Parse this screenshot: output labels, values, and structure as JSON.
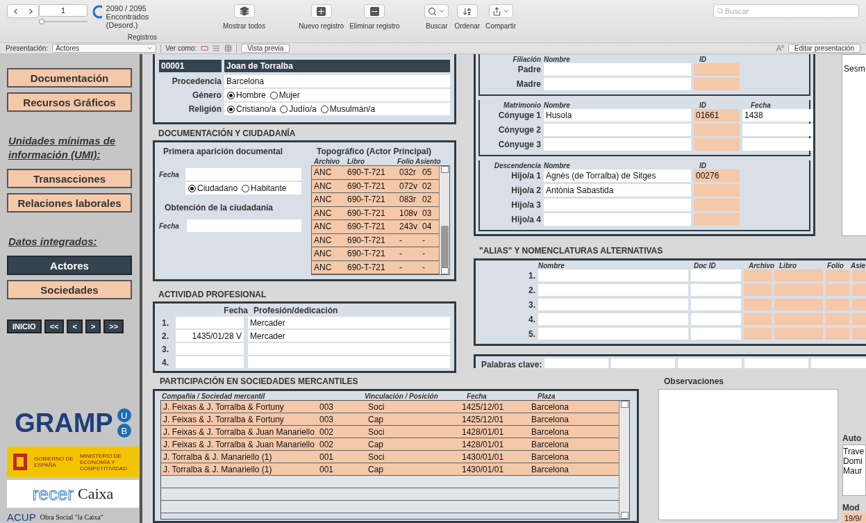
{
  "toolbar": {
    "record_field": {
      "value": "1"
    },
    "record_slider": {
      "level": 0.0
    },
    "found_count": "2090 / 2095",
    "found_status": "Encontrados (Desord.)",
    "records_label": "Registros",
    "actions": [
      {
        "kind": "show_all",
        "label": "Mostrar todos"
      },
      {
        "kind": "new",
        "label": "Nuevo registro"
      },
      {
        "kind": "delete",
        "label": "Eliminar registro"
      },
      {
        "kind": "search",
        "label": "Buscar"
      },
      {
        "kind": "sort",
        "label": "Ordenar"
      },
      {
        "kind": "share",
        "label": "Compartir"
      }
    ],
    "search": {
      "placeholder": "Buscar"
    }
  },
  "layout_bar": {
    "presentation_label": "Presentación:",
    "presentation_value": "Actores",
    "view_label": "Ver como:",
    "view_modes": [
      {
        "kind": "form",
        "selected": true
      },
      {
        "kind": "list",
        "selected": false
      },
      {
        "kind": "table",
        "selected": false
      }
    ],
    "preview_button": "Vista previa",
    "edit_button": "Editar presentación"
  },
  "sidebar": {
    "items": [
      {
        "kind": "button",
        "label": "Documentación",
        "selected": false
      },
      {
        "kind": "button",
        "label": "Recursos Gráficos",
        "selected": false
      },
      {
        "kind": "heading",
        "label": "Unidades mínimas de información (UMI):"
      },
      {
        "kind": "button",
        "label": "Transacciones",
        "selected": false
      },
      {
        "kind": "button",
        "label": "Relaciones laborales",
        "selected": false
      },
      {
        "kind": "heading",
        "label": "Datos integrados:"
      },
      {
        "kind": "button",
        "label": "Actores",
        "selected": true
      },
      {
        "kind": "button",
        "label": "Sociedades",
        "selected": false
      }
    ],
    "nav": [
      "INICIO",
      "<<",
      "<",
      ">",
      ">>"
    ],
    "logos": [
      {
        "kind": "gramp",
        "texts": [
          "GRAMP",
          "U",
          "B"
        ]
      },
      {
        "kind": "gobierno",
        "texts": [
          "GOBIERNO DE ESPAÑA",
          "MINISTERIO DE ECONOMÍA Y COMPETITIVIDAD"
        ]
      },
      {
        "kind": "recercaixa",
        "texts": [
          "recer",
          "Caixa"
        ]
      },
      {
        "kind": "acup",
        "texts": [
          "ACUP",
          "Obra Social \"la Caixa\""
        ]
      }
    ]
  },
  "actor": {
    "id": "00001",
    "name": "Joan de Torralba",
    "procedencia_label": "Procedencia",
    "procedencia": "Barcelona",
    "genero_label": "Género",
    "genero_options": [
      {
        "label": "Hombre",
        "selected": true
      },
      {
        "label": "Mujer",
        "selected": false
      }
    ],
    "religion_label": "Religión",
    "religion_options": [
      {
        "label": "Cristiano/a",
        "selected": true
      },
      {
        "label": "Judío/a",
        "selected": false
      },
      {
        "label": "Musulmán/a",
        "selected": false
      }
    ]
  },
  "documentacion": {
    "title": "DOCUMENTACIÓN Y CIUDADANÍA",
    "primera": {
      "title": "Primera aparición documental",
      "date_label": "Fecha"
    },
    "status_options": [
      {
        "label": "Ciudadano",
        "selected": true
      },
      {
        "label": "Habitante",
        "selected": false
      }
    ],
    "obtencion": {
      "title": "Obtención de la ciudadanía",
      "date_label": "Fecha"
    },
    "topografico": {
      "title": "Topográfico (Actor Principal)",
      "columns": [
        "Archivo",
        "Libro",
        "Folio",
        "Asiento"
      ],
      "rows": [
        [
          "ANC",
          "690-T-721",
          "032r",
          "05"
        ],
        [
          "ANC",
          "690-T-721",
          "072v",
          "02"
        ],
        [
          "ANC",
          "690-T-721",
          "083r",
          "02"
        ],
        [
          "ANC",
          "690-T-721",
          "108v",
          "03"
        ],
        [
          "ANC",
          "690-T-721",
          "243v",
          "04"
        ],
        [
          "ANC",
          "690-T-721",
          "-",
          "-"
        ],
        [
          "ANC",
          "690-T-721",
          "-",
          "-"
        ],
        [
          "ANC",
          "690-T-721",
          "-",
          "-"
        ]
      ]
    }
  },
  "actividad": {
    "title": "ACTIVIDAD PROFESIONAL",
    "columns": [
      "Fecha",
      "Profesión/dedicación"
    ],
    "rows": [
      {
        "number": "1.",
        "profession": "Mercader"
      },
      {
        "number": "2.",
        "date": "1435/01/28 V",
        "profession": "Mercader"
      },
      {
        "number": "3."
      },
      {
        "number": "4."
      }
    ]
  },
  "family": [
    {
      "label": "Filiación",
      "columns": [
        "Nombre",
        "ID"
      ],
      "rows": [
        {
          "label": "Padre"
        },
        {
          "label": "Madre"
        }
      ]
    },
    {
      "label": "Matrimonio",
      "columns": [
        "Nombre",
        "ID",
        "Fecha"
      ],
      "rows": [
        {
          "label": "Cónyuge 1",
          "name": "Husola",
          "id": "01661",
          "date": "1438"
        },
        {
          "label": "Cónyuge 2"
        },
        {
          "label": "Cónyuge 3"
        }
      ]
    },
    {
      "label": "Descendencia",
      "columns": [
        "Nombre",
        "ID"
      ],
      "rows": [
        {
          "label": "Hijo/a 1",
          "name": "Agnès (de Torralba) de Sitges",
          "id": "00276"
        },
        {
          "label": "Hijo/a 2",
          "name": "Antònia Sabastida"
        },
        {
          "label": "Hijo/a 3"
        },
        {
          "label": "Hijo/a 4"
        }
      ]
    }
  ],
  "alias": {
    "title": "\"ALIAS\" Y NOMENCLATURAS ALTERNATIVAS",
    "columns": [
      "Nombre",
      "Doc ID",
      "Archivo",
      "Libro",
      "Folio",
      "Asie"
    ],
    "rows": [
      "1.",
      "2.",
      "3.",
      "4.",
      "5."
    ]
  },
  "keywords": {
    "label": "Palabras clave:"
  },
  "participacion": {
    "title": "PARTICIPACIÓN EN SOCIEDADES MERCANTILES",
    "columns": [
      "Compañía / Sociedad mercantil",
      "Vinculación / Posición",
      "Fecha",
      "Plaza"
    ],
    "rows": [
      {
        "company": "J. Feixas & J. Torralba & Fortuny",
        "code": "003",
        "role": "Soci",
        "date": "1425/12/01",
        "place": "Barcelona"
      },
      {
        "company": "J. Feixas & J. Torralba & Fortuny",
        "code": "003",
        "role": "Cap",
        "date": "1425/12/01",
        "place": "Barcelona"
      },
      {
        "company": "J. Feixas & J. Torralba & Juan Manariello",
        "code": "002",
        "role": "Soci",
        "date": "1428/01/01",
        "place": "Barcelona"
      },
      {
        "company": "J. Feixas & J. Torralba & Juan Manariello",
        "code": "002",
        "role": "Cap",
        "date": "1428/01/01",
        "place": "Barcelona"
      },
      {
        "company": "J. Torralba & J. Manariello (1)",
        "code": "001",
        "role": "Soci",
        "date": "1430/01/01",
        "place": "Barcelona"
      },
      {
        "company": "J. Torralba & J. Manariello (1)",
        "code": "001",
        "role": "Cap",
        "date": "1430/01/01",
        "place": "Barcelona"
      }
    ]
  },
  "observaciones": {
    "title": "Observaciones"
  },
  "side_strip": {
    "top_text": "Sesm",
    "author_label": "Auto",
    "authors": [
      "Trave",
      "Domi",
      "Maur"
    ],
    "modified_label": "Mod",
    "modified": "19/9/"
  }
}
